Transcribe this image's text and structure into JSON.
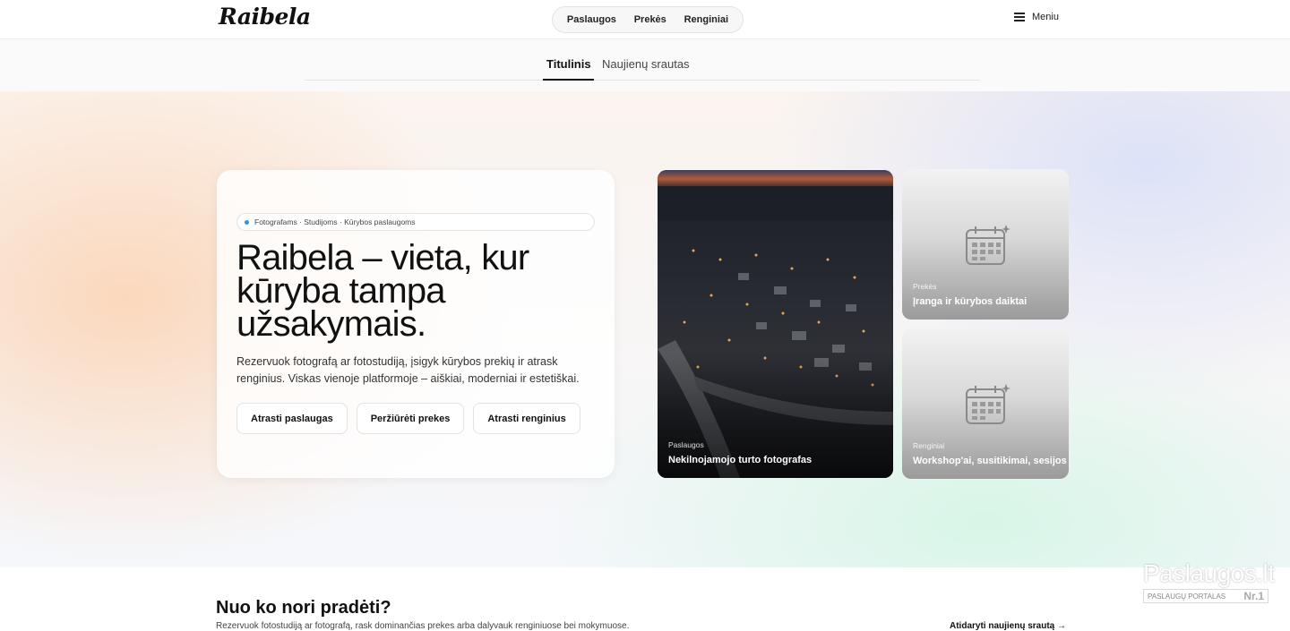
{
  "header": {
    "logo": "Raibela",
    "nav": [
      "Paslaugos",
      "Prekės",
      "Renginiai"
    ],
    "menu_label": "Meniu"
  },
  "subnav": {
    "tabs": [
      "Titulinis",
      "Naujienų srautas"
    ],
    "active_tab": "Titulinis"
  },
  "hero": {
    "chip": "Fotografams · Studijoms · Kūrybos paslaugoms",
    "title_lines": [
      "Raibela – vieta, kur",
      "kūryba tampa",
      "užsakymais."
    ],
    "subtitle_lines": [
      "Rezervuok fotografą ar fotostudiją, įsigyk kūrybos prekių ir atrask",
      "renginius. Viskas vienoje platformoje – aiškiai, moderniai ir estetiškai."
    ],
    "buttons": [
      "Atrasti paslaugas",
      "Peržiūrėti prekes",
      "Atrasti renginius"
    ]
  },
  "cards": [
    {
      "category": "Paslaugos",
      "title": "Nekilnojamojo turto fotografas",
      "image": "aerial-night-town"
    },
    {
      "category": "Prekės",
      "title": "Įranga ir kūrybos daiktai",
      "icon": "calendar-icon"
    },
    {
      "category": "Renginiai",
      "title": "Workshop'ai, susitikimai, sesijos",
      "icon": "calendar-icon"
    }
  ],
  "section": {
    "title": "Nuo ko nori pradėti?",
    "subtitle": "Rezervuok fotostudiją ar fotografą, rask dominančias prekes arba dalyvauk renginiuose bei mokymuose.",
    "link": "Atidaryti naujienų srautą →"
  },
  "watermark": {
    "brand": "Paslaugos.lt",
    "tagline": "PASLAUGŲ PORTALAS",
    "rank": "Nr.1"
  }
}
